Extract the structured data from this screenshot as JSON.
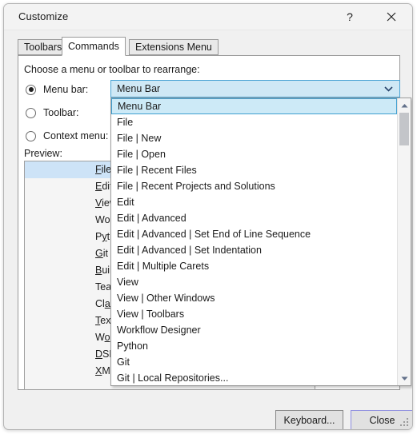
{
  "window": {
    "title": "Customize",
    "help_icon": "question-mark-icon",
    "close_icon": "close-icon"
  },
  "tabs": [
    {
      "label": "Toolbars",
      "active": false
    },
    {
      "label": "Commands",
      "active": true
    },
    {
      "label": "Extensions Menu",
      "active": false
    }
  ],
  "page": {
    "choose_label": "Choose a menu or toolbar to rearrange:",
    "preview_label": "Preview:"
  },
  "radios": [
    {
      "label": "Menu bar:",
      "checked": true
    },
    {
      "label": "Toolbar:",
      "checked": false
    },
    {
      "label": "Context menu:",
      "checked": false
    }
  ],
  "combobox": {
    "value": "Menu Bar",
    "arrow_icon": "chevron-down-icon",
    "expanded": true
  },
  "dropdown": {
    "items": [
      "Menu Bar",
      "File",
      "File | New",
      "File | Open",
      "File | Recent Files",
      "File | Recent Projects and Solutions",
      "Edit",
      "Edit | Advanced",
      "Edit | Advanced | Set End of Line Sequence",
      "Edit | Advanced | Set Indentation",
      "Edit | Multiple Carets",
      "View",
      "View | Other Windows",
      "View | Toolbars",
      "Workflow Designer",
      "Python",
      "Git",
      "Git | Local Repositories..."
    ],
    "selected_index": 0,
    "scrollbar": {
      "up_icon": "scroll-up-arrow-icon",
      "down_icon": "scroll-down-arrow-icon"
    }
  },
  "preview": {
    "items": [
      {
        "pre": "",
        "mnemonic": "F",
        "post": "ile",
        "selected": true
      },
      {
        "pre": "",
        "mnemonic": "E",
        "post": "dit",
        "selected": false
      },
      {
        "pre": "",
        "mnemonic": "V",
        "post": "iew",
        "selected": false
      },
      {
        "pre": "Workflow D",
        "mnemonic": "e",
        "post": "signer",
        "selected": false
      },
      {
        "pre": "P",
        "mnemonic": "y",
        "post": "thon",
        "selected": false
      },
      {
        "pre": "",
        "mnemonic": "G",
        "post": "it",
        "selected": false
      },
      {
        "pre": "",
        "mnemonic": "B",
        "post": "uild",
        "selected": false
      },
      {
        "pre": "Tea",
        "mnemonic": "m",
        "post": "",
        "selected": false
      },
      {
        "pre": "Cl",
        "mnemonic": "a",
        "post": "ss Diagram",
        "selected": false
      },
      {
        "pre": "",
        "mnemonic": "T",
        "post": "ext Transform",
        "selected": false
      },
      {
        "pre": "W",
        "mnemonic": "o",
        "post": "rkflow",
        "selected": false
      },
      {
        "pre": "",
        "mnemonic": "D",
        "post": "SL Tools",
        "selected": false
      },
      {
        "pre": "",
        "mnemonic": "X",
        "post": "ML",
        "selected": false
      }
    ]
  },
  "footer": {
    "keyboard_label": "Keyboard...",
    "close_label": "Close"
  }
}
